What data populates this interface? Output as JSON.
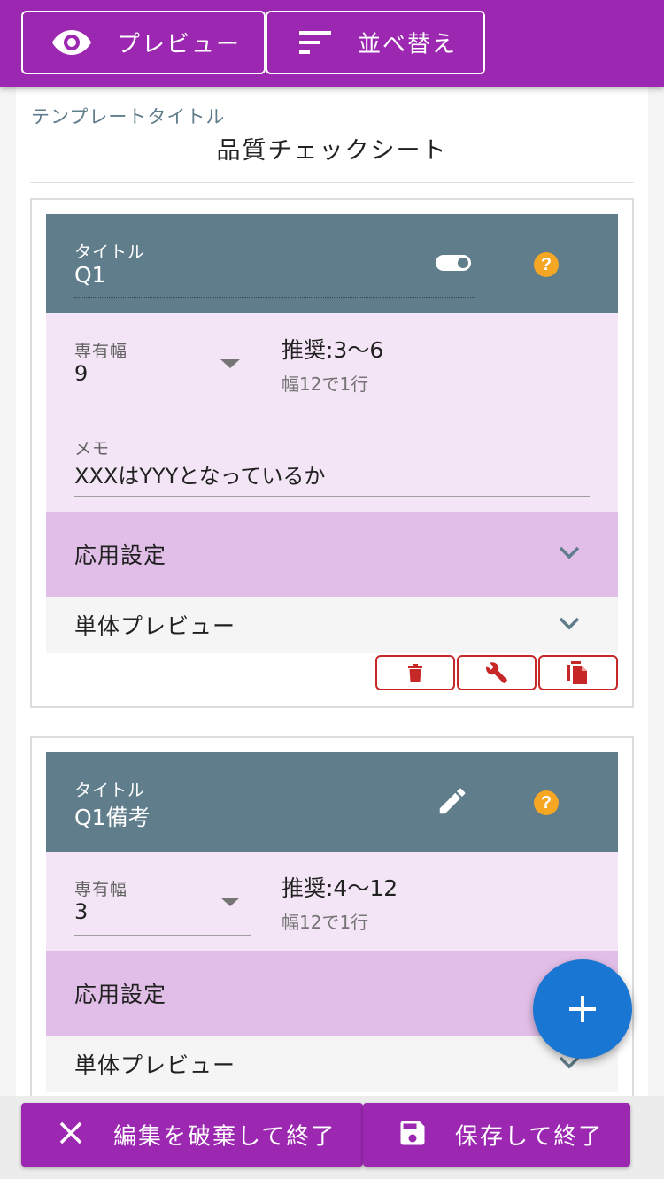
{
  "toolbar": {
    "preview_label": "プレビュー",
    "sort_label": "並べ替え"
  },
  "template": {
    "label": "テンプレートタイトル",
    "title": "品質チェックシート"
  },
  "cards": [
    {
      "title_label": "タイトル",
      "title_value": "Q1",
      "width_label": "専有幅",
      "width_value": "9",
      "recommend": "推奨:3〜6",
      "recommend_note": "幅12で1行",
      "memo_label": "メモ",
      "memo_value": "XXXはYYYとなっているか",
      "advanced_label": "応用設定",
      "single_preview_label": "単体プレビュー"
    },
    {
      "title_label": "タイトル",
      "title_value": "Q1備考",
      "width_label": "専有幅",
      "width_value": "3",
      "recommend": "推奨:4〜12",
      "recommend_note": "幅12で1行",
      "advanced_label": "応用設定",
      "single_preview_label": "単体プレビュー"
    }
  ],
  "footer": {
    "discard_label": "編集を破棄して終了",
    "save_label": "保存して終了"
  },
  "colors": {
    "primary": "#9c27b0",
    "header": "#607d8b",
    "help": "#f5a623",
    "danger": "#c62828",
    "fab": "#1976d2"
  }
}
